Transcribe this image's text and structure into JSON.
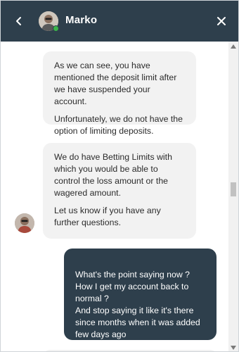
{
  "header": {
    "agent_name": "Marko",
    "back_icon": "chevron-left-icon",
    "close_icon": "close-icon",
    "status": "online",
    "colors": {
      "header_bg": "#2e3f4c",
      "online": "#3bb54a"
    }
  },
  "messages": [
    {
      "sender": "agent",
      "paragraphs": [
        "As we can see, you have mentioned the deposit limit after we have suspended your account.",
        "Unfortunately, we do not have the option of limiting deposits."
      ]
    },
    {
      "sender": "agent",
      "paragraphs": [
        "We do have Betting Limits with which you would be able to control the loss amount or the wagered amount.",
        "Let us know if you have any further questions."
      ]
    },
    {
      "sender": "user",
      "paragraphs": [
        "What's the point saying now ? How I get my account back to normal ?\nAnd stop saying it like it's there since months when it was added few days ago"
      ]
    }
  ],
  "colors": {
    "agent_bubble": "#f2f2f2",
    "user_bubble": "#2e3f4c"
  }
}
